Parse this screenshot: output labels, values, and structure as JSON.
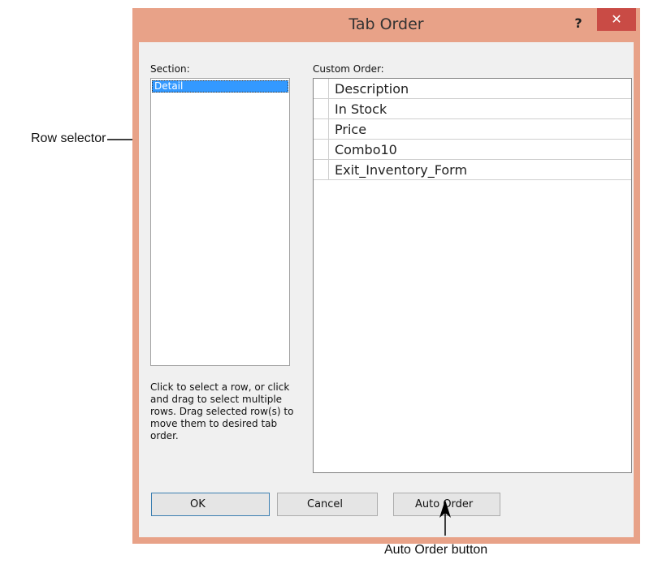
{
  "dialog": {
    "title": "Tab Order",
    "help_label": "?",
    "close_label": "✕"
  },
  "section": {
    "label": "Section:",
    "items": [
      "Detail"
    ]
  },
  "custom_order": {
    "label": "Custom Order:",
    "rows": [
      "Description",
      "In Stock",
      "Price",
      "Combo10",
      "Exit_Inventory_Form"
    ]
  },
  "help_text": "Click to select a row, or click and drag to select multiple rows.  Drag selected row(s) to move them to desired tab order.",
  "buttons": {
    "ok": "OK",
    "cancel": "Cancel",
    "auto_order": "Auto Order"
  },
  "callouts": {
    "row_selector": "Row selector",
    "auto_order_button": "Auto Order button"
  }
}
